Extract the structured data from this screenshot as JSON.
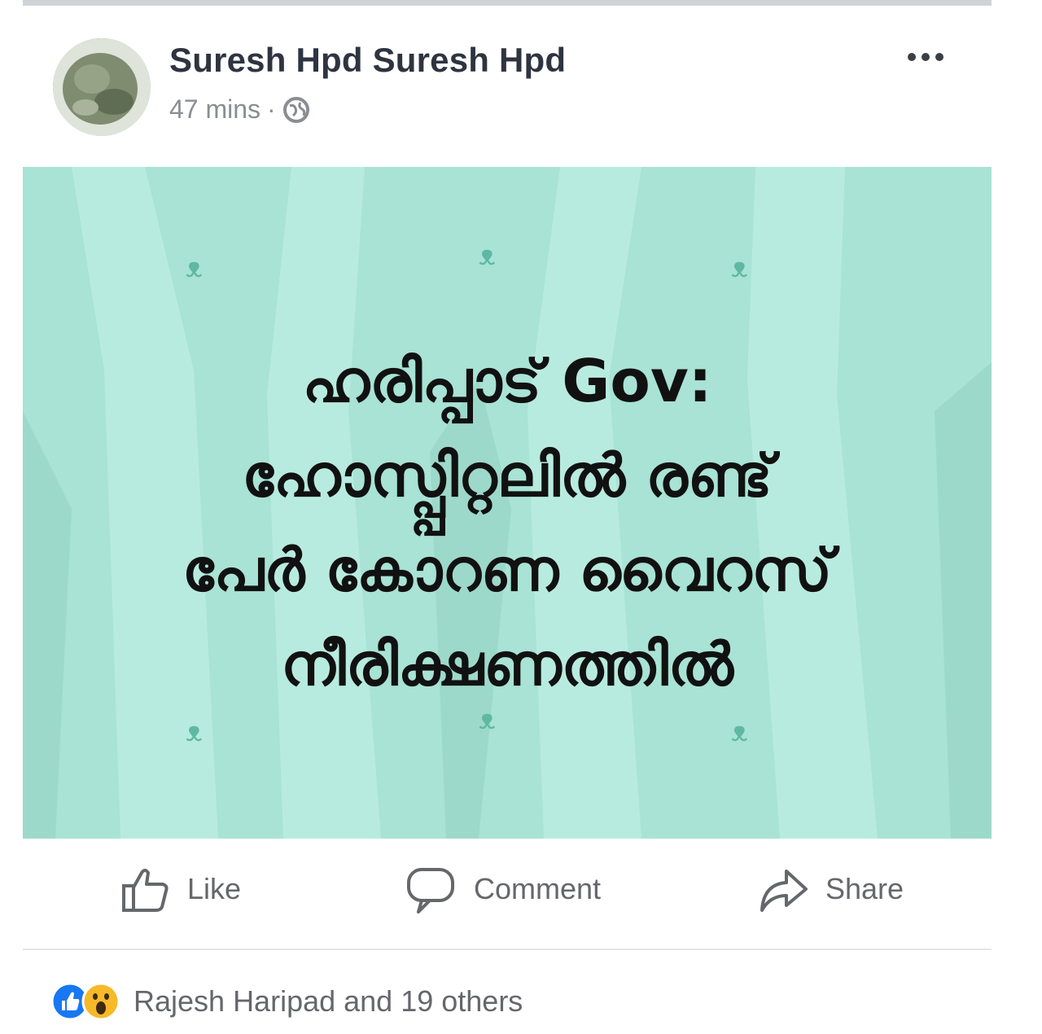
{
  "post": {
    "author": "Suresh Hpd Suresh Hpd",
    "time": "47 mins",
    "separator": "·",
    "privacy_icon": "globe-icon",
    "menu_icon": "more-options-icon",
    "image_text_lines": [
      "ഹരിപ്പാട് Gov:",
      "ഹോസ്പ്പിറ്റലിൽ രണ്ട്",
      "പേർ കോറണ വൈറസ്",
      "നീരിക്ഷണത്തിൽ"
    ]
  },
  "actions": {
    "like": "Like",
    "comment": "Comment",
    "share": "Share"
  },
  "reactions": {
    "summary": "Rajesh Haripad and 19 others",
    "icons": [
      "like-reaction-icon",
      "wow-reaction-icon"
    ]
  },
  "colors": {
    "image_background": "#a8e3d5",
    "action_gray": "#65676b",
    "like_blue": "#1877f2",
    "wow_yellow": "#f7b928"
  }
}
